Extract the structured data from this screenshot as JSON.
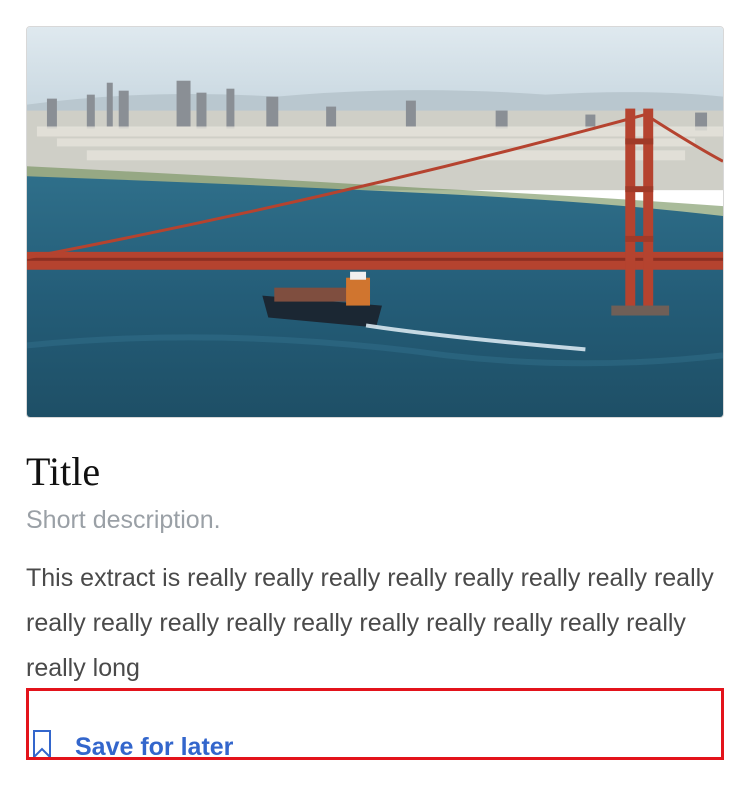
{
  "card": {
    "image_alt": "Golden Gate Bridge with container ship and San Francisco skyline",
    "title": "Title",
    "description": "Short description.",
    "extract": "This extract is really really really really really really really really really really really really really really really really really really really long",
    "save_action": {
      "label": "Save for later",
      "icon": "bookmark-icon"
    }
  },
  "colors": {
    "link": "#3366cc",
    "highlight_border": "#e3131b",
    "description": "#9aa0a6",
    "body_text": "#4a4a4a"
  }
}
